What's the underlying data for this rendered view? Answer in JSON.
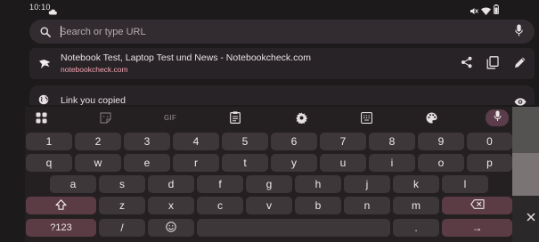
{
  "status": {
    "time": "10:10",
    "icons": [
      "cloud-icon",
      "mute-icon",
      "wifi-icon",
      "battery-icon"
    ]
  },
  "search": {
    "placeholder": "Search or type URL",
    "value": ""
  },
  "suggestion": {
    "title": "Notebook Test, Laptop Test und News - Notebookcheck.com",
    "url": "notebookcheck.com",
    "actions": [
      "share-icon",
      "copy-icon",
      "edit-icon"
    ]
  },
  "clipboard": {
    "label": "Link you copied"
  },
  "keyboard": {
    "toolbar": [
      "apps-icon",
      "sticker-icon",
      "GIF",
      "clipboard-icon",
      "settings-icon",
      "keyboard-layout-icon",
      "palette-icon",
      "mic-icon"
    ],
    "gif_label": "GIF",
    "row_numbers": [
      "1",
      "2",
      "3",
      "4",
      "5",
      "6",
      "7",
      "8",
      "9",
      "0"
    ],
    "row1": [
      "q",
      "w",
      "e",
      "r",
      "t",
      "y",
      "u",
      "i",
      "o",
      "p"
    ],
    "row2": [
      "a",
      "s",
      "d",
      "f",
      "g",
      "h",
      "j",
      "k",
      "l"
    ],
    "row3": [
      "z",
      "x",
      "c",
      "v",
      "b",
      "n",
      "m"
    ],
    "symbols_label": "?123",
    "slash_label": "/",
    "period_label": ".",
    "enter_glyph": "→"
  },
  "colors": {
    "surface": "#1d1a1c",
    "search_bg": "#322c30",
    "url_pink": "#f4a5b5",
    "key_bg": "#3d3739",
    "key_accent": "#5b3c44"
  }
}
